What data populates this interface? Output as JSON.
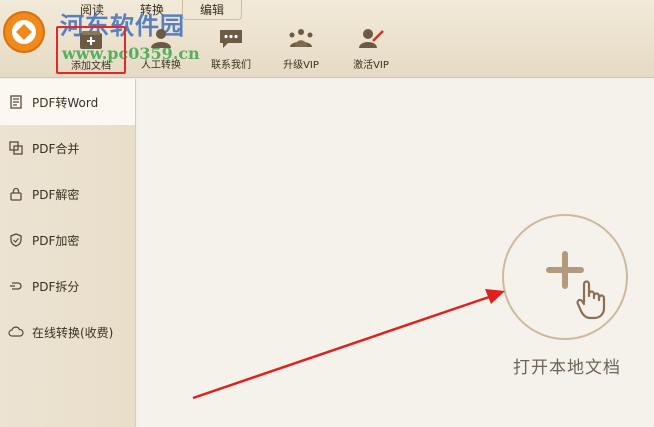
{
  "watermark": {
    "name": "河东软件园",
    "url": "www.pc0359.cn"
  },
  "tabs": [
    {
      "label": "阅读"
    },
    {
      "label": "转换"
    },
    {
      "label": "编辑"
    }
  ],
  "toolbar": [
    {
      "label": "添加文档",
      "icon": "add-document-icon",
      "highlighted": true
    },
    {
      "label": "人工转换",
      "icon": "person-icon"
    },
    {
      "label": "联系我们",
      "icon": "chat-icon"
    },
    {
      "label": "升级VIP",
      "icon": "crown-icon"
    },
    {
      "label": "激活VIP",
      "icon": "activate-user-icon"
    }
  ],
  "sidebar": {
    "items": [
      {
        "label": "PDF转Word",
        "icon": "document-icon",
        "active": true
      },
      {
        "label": "PDF合并",
        "icon": "merge-icon"
      },
      {
        "label": "PDF解密",
        "icon": "lock-icon"
      },
      {
        "label": "PDF加密",
        "icon": "shield-icon"
      },
      {
        "label": "PDF拆分",
        "icon": "split-icon"
      },
      {
        "label": "在线转换(收费)",
        "icon": "cloud-icon"
      }
    ]
  },
  "main": {
    "open_label": "打开本地文档"
  },
  "colors": {
    "highlight": "#e02a2a",
    "accent": "#b49a7c"
  }
}
